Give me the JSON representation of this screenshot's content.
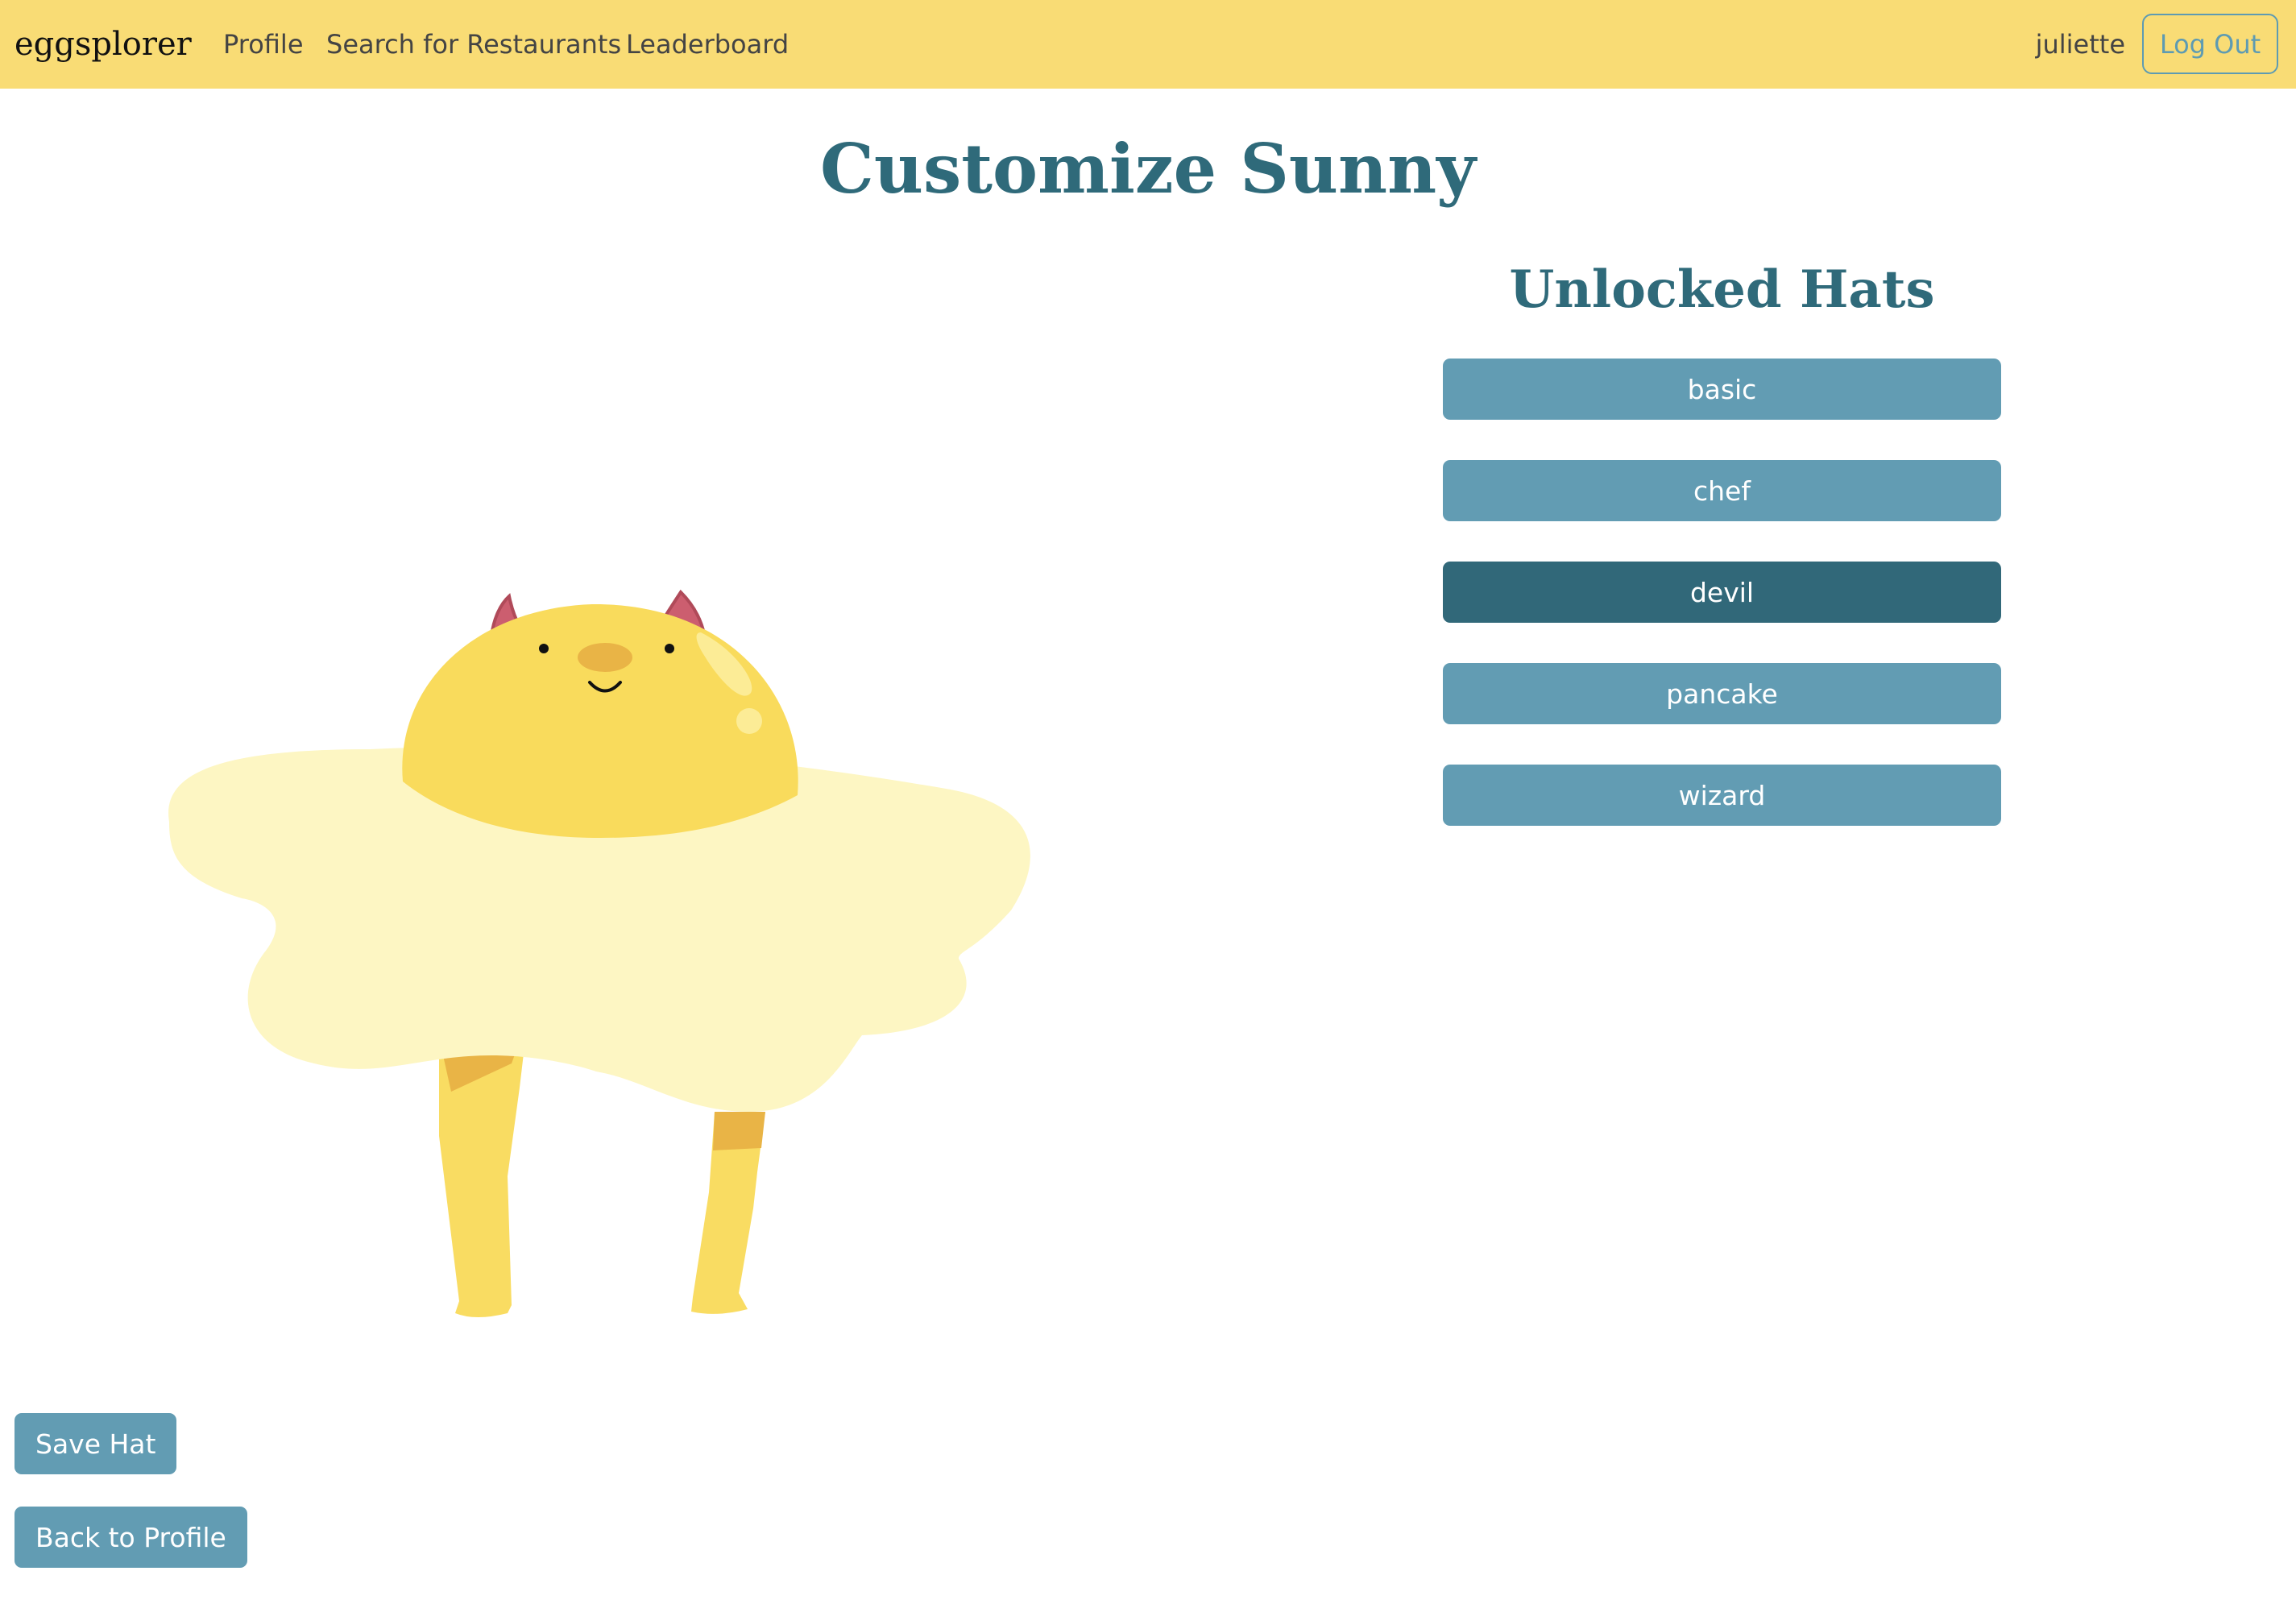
{
  "navbar": {
    "brand": "eggsplorer",
    "links": [
      "Profile",
      "Search for Restaurants",
      "Leaderboard"
    ],
    "username": "juliette",
    "logout_label": "Log Out",
    "background_color": "#f9dc75"
  },
  "page": {
    "title": "Customize Sunny"
  },
  "hats": {
    "title": "Unlocked Hats",
    "items": [
      {
        "label": "basic",
        "selected": false
      },
      {
        "label": "chef",
        "selected": false
      },
      {
        "label": "devil",
        "selected": true
      },
      {
        "label": "pancake",
        "selected": false
      },
      {
        "label": "wizard",
        "selected": false
      }
    ]
  },
  "character": {
    "name": "Sunny",
    "hat": "devil"
  },
  "actions": {
    "save_label": "Save Hat",
    "back_label": "Back to Profile"
  },
  "colors": {
    "accent": "#629cb3",
    "accent_selected": "#316879",
    "title": "#2f6a7a"
  }
}
